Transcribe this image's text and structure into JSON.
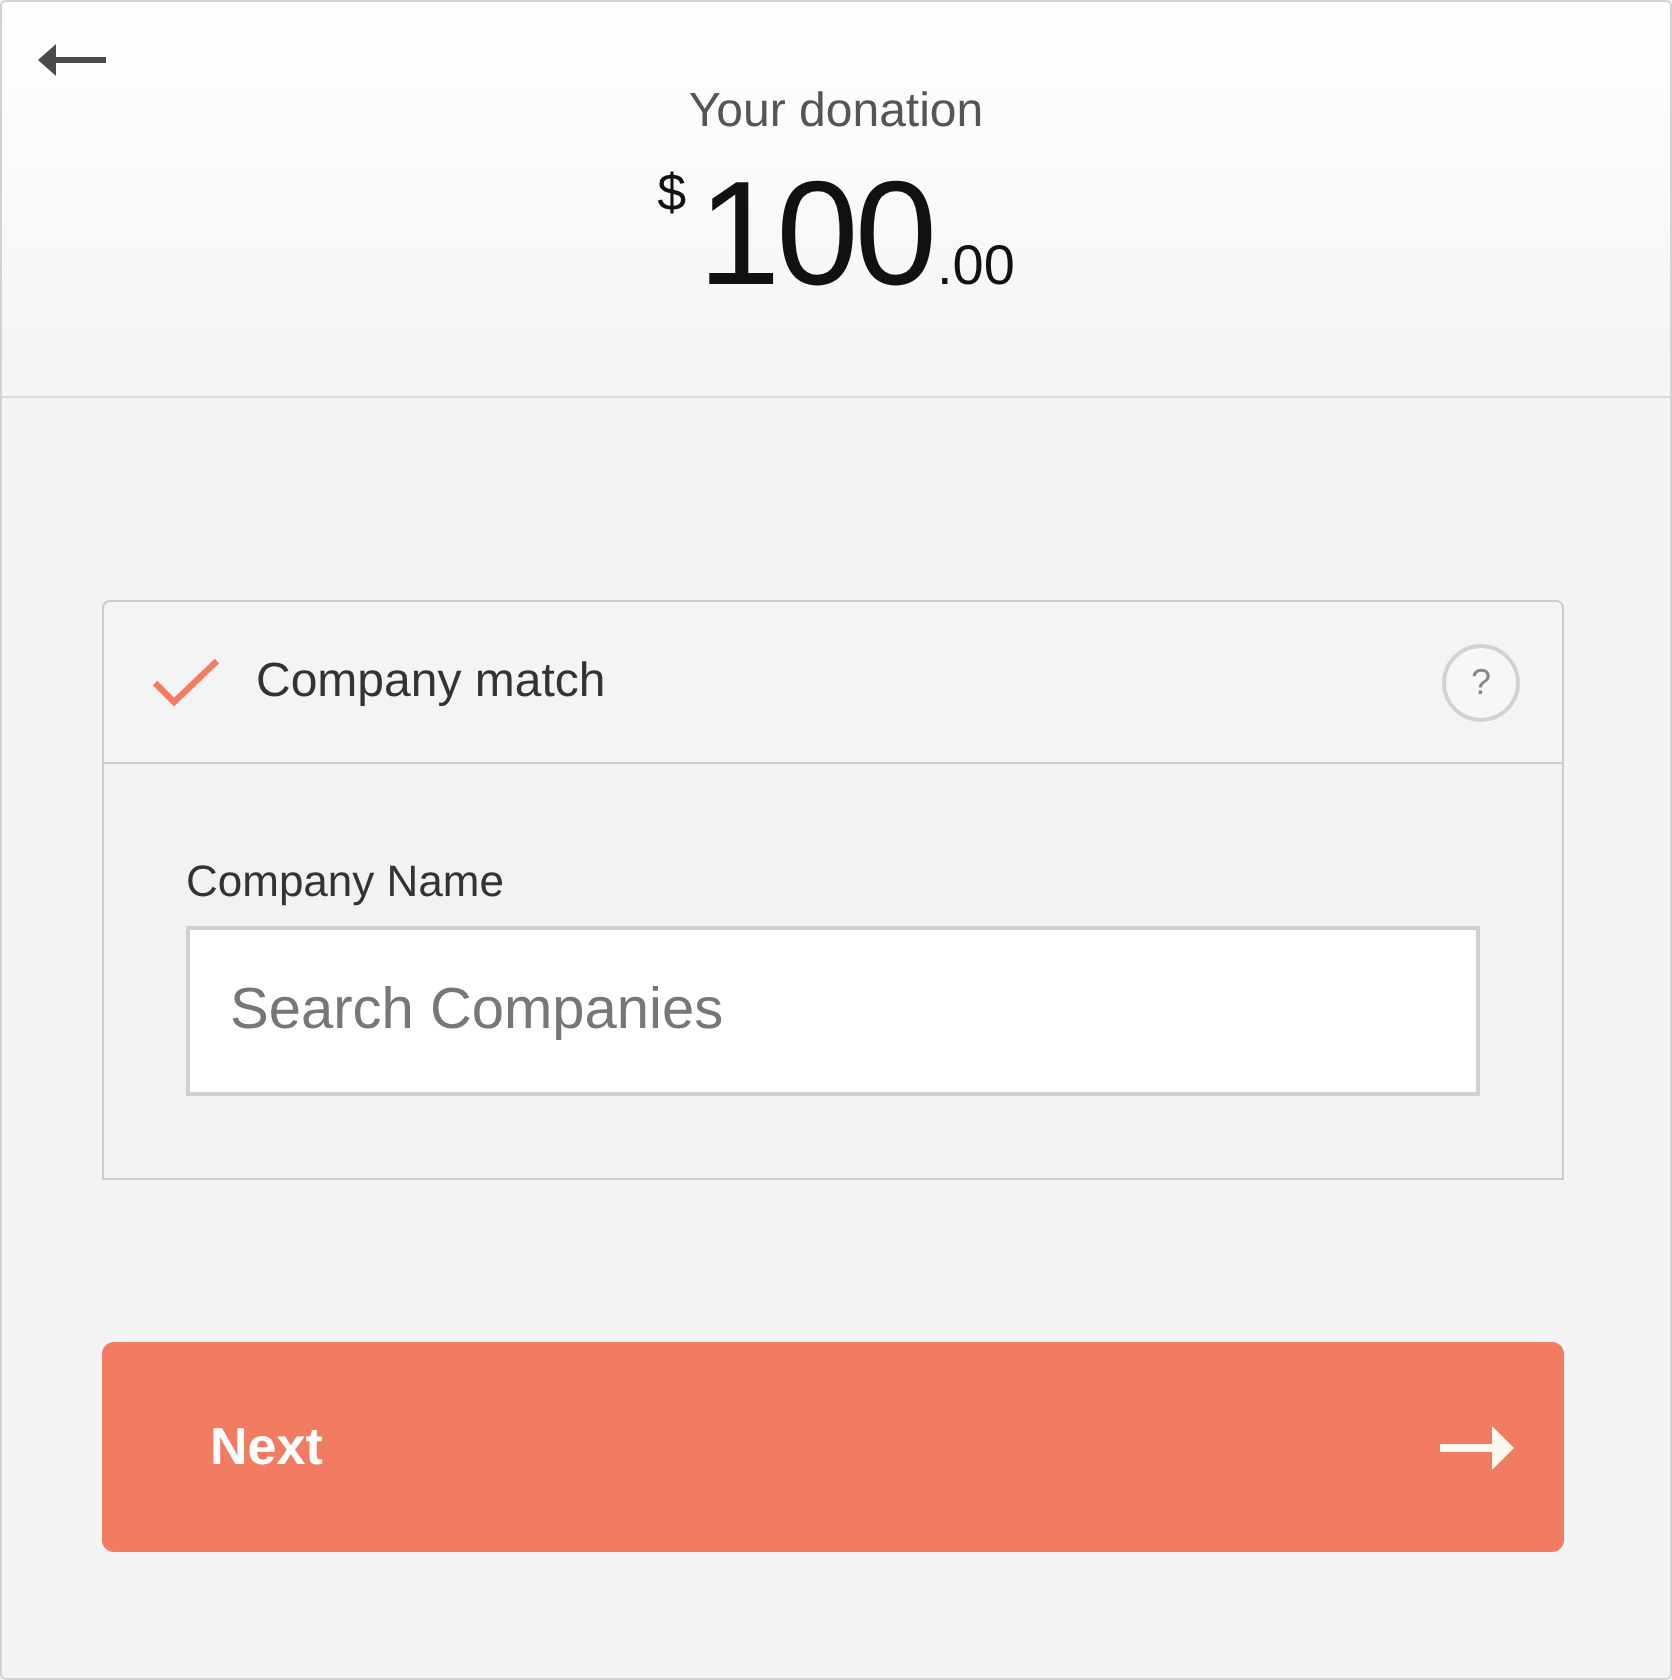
{
  "header": {
    "title": "Your donation",
    "amount": {
      "currency": "$",
      "whole": "100",
      "cents": ".00"
    }
  },
  "company_match": {
    "label": "Company match",
    "checked": true,
    "expanded": true,
    "help": "?",
    "field": {
      "label": "Company Name",
      "placeholder": "Search Companies"
    }
  },
  "next_button": {
    "label": "Next"
  }
}
